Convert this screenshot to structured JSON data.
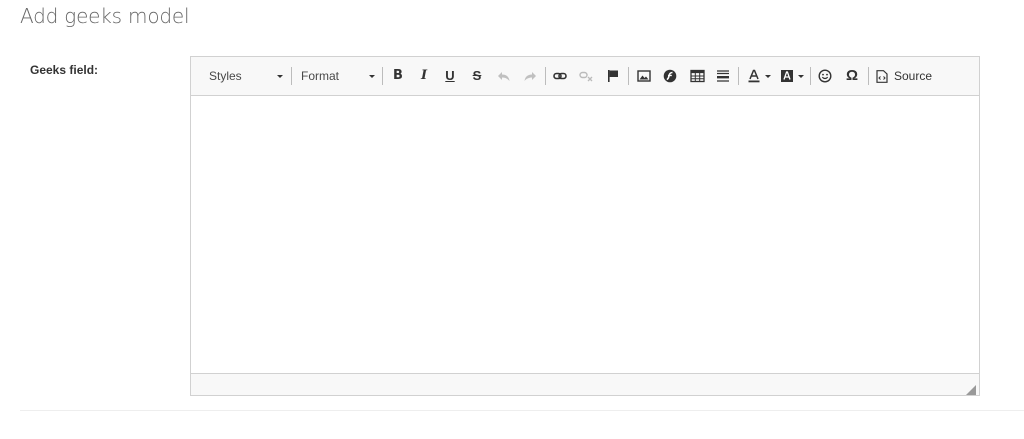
{
  "page": {
    "title": "Add geeks model"
  },
  "form": {
    "field_label": "Geeks field:"
  },
  "editor": {
    "content": "",
    "toolbar": {
      "styles_label": "Styles",
      "format_label": "Format",
      "bold_glyph": "B",
      "italic_glyph": "I",
      "underline_glyph": "U",
      "strike_glyph": "S",
      "omega_glyph": "Ω",
      "source_label": "Source",
      "buttons": [
        "bold-icon",
        "italic-icon",
        "underline-icon",
        "strikethrough-icon",
        "undo-icon",
        "redo-icon",
        "link-icon",
        "unlink-icon",
        "anchor-flag-icon",
        "image-icon",
        "flash-icon",
        "table-icon",
        "horizontal-line-icon",
        "text-color-icon",
        "background-color-icon",
        "smiley-icon",
        "special-character-icon",
        "source-icon"
      ]
    }
  },
  "colors": {
    "toolbar_bg": "#f8f8f8",
    "border": "#d1d1d1",
    "title_text": "#666666",
    "label_text": "#333333"
  }
}
